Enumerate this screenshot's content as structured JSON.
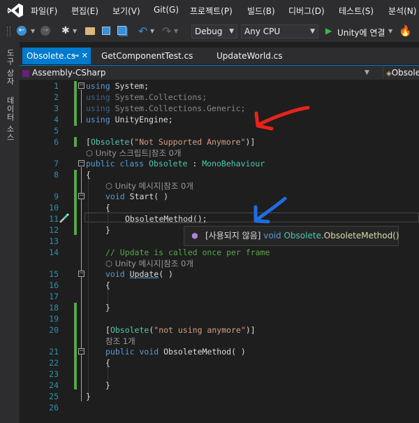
{
  "menu": [
    "파일(F)",
    "편집(E)",
    "보기(V)",
    "Git(G)",
    "프로젝트(P)",
    "빌드(B)",
    "디버그(D)",
    "테스트(S)",
    "분석(N)"
  ],
  "toolbar": {
    "config": "Debug",
    "platform": "Any CPU",
    "run_label": "Unity에 연결"
  },
  "side_tabs": [
    "도구 상자",
    "데이터 소스"
  ],
  "tabs": [
    {
      "label": "Obsolete.cs",
      "pin": "⊸ ✕"
    },
    {
      "label": "GetComponentTest.cs"
    },
    {
      "label": "UpdateWorld.cs"
    }
  ],
  "nav": {
    "project": "Assembly-CSharp",
    "class": "Obsolete"
  },
  "line_numbers": [
    "1",
    "2",
    "3",
    "4",
    "5",
    "6",
    "7",
    "8",
    "9",
    "10",
    "11",
    "12",
    "13",
    "14",
    "15",
    "16",
    "17",
    "18",
    "19",
    "20",
    "21",
    "22",
    "23",
    "24",
    "25",
    "26"
  ],
  "code": {
    "using_kw": "using",
    "l1_ns": "System",
    "l2_ns": "System.Collections",
    "l3_ns": "System.Collections.Generic",
    "l4_ns": "UnityEngine",
    "semicolon": ";",
    "attr_open": "[",
    "attr_name": "Obsolete",
    "l6_str": "\"Not Supported Anymore\"",
    "paren_open": "(",
    "paren_close": ")",
    "attr_close": "]",
    "lens_class": "Unity 스크립트|참조 0개",
    "l7_public": "public",
    "l7_class": "class",
    "l7_name": "Obsolete",
    "l7_colon": " : ",
    "l7_base": "MonoBehaviour",
    "brace_open": "{",
    "brace_close": "}",
    "lens_start": "Unity 메시지|참조 0개",
    "void_kw": "void",
    "l9_name": "Start",
    "l9_params": "( )",
    "l11_call": "ObsoleteMethod();",
    "l14_comment": "// Update is called once per frame",
    "lens_update": "Unity 메시지|참조 0개",
    "l15_name": "Update",
    "l20_str": "\"not using anymore\"",
    "lens_method": "참조 1개",
    "l21_name": "ObsoleteMethod",
    "l21_params": "( )"
  },
  "tooltip": {
    "tag": "[사용되지 않음]",
    "kw": "void",
    "cls": "Obsolete",
    "dot": ".",
    "method": "ObsoleteMethod()"
  },
  "colors": {
    "accent": "#007acc",
    "keyword": "#569cd6",
    "type": "#4ec9b0",
    "string": "#d69d85",
    "comment": "#57a64a",
    "annotation_red": "#e8221c",
    "annotation_blue": "#1f6de0"
  },
  "icons": [
    "visual-studio-logo",
    "back-arrow-icon",
    "forward-arrow-icon",
    "new-project-icon",
    "open-folder-icon",
    "save-icon",
    "save-all-icon",
    "undo-icon",
    "redo-icon",
    "play-icon",
    "quick-action-icon",
    "unity-icon",
    "method-icon"
  ]
}
